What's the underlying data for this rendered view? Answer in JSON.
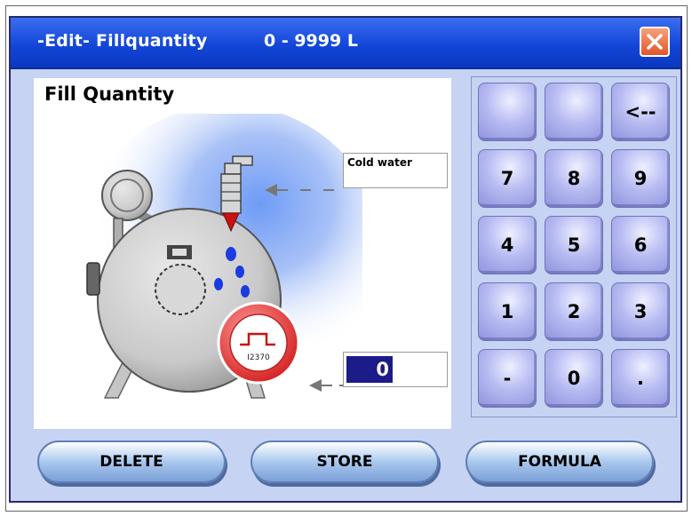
{
  "window": {
    "title": "-Edit- Fillquantity",
    "range": "0 - 9999 L",
    "close_icon": "close-icon"
  },
  "panel": {
    "title": "Fill Quantity",
    "description": "Cold water",
    "value": "0",
    "meter_label": "I2370"
  },
  "keypad": {
    "keys": [
      {
        "label": "",
        "name": "key-blank-1"
      },
      {
        "label": "",
        "name": "key-blank-2"
      },
      {
        "label": "<--",
        "name": "key-backspace"
      },
      {
        "label": "7",
        "name": "key-7"
      },
      {
        "label": "8",
        "name": "key-8"
      },
      {
        "label": "9",
        "name": "key-9"
      },
      {
        "label": "4",
        "name": "key-4"
      },
      {
        "label": "5",
        "name": "key-5"
      },
      {
        "label": "6",
        "name": "key-6"
      },
      {
        "label": "1",
        "name": "key-1"
      },
      {
        "label": "2",
        "name": "key-2"
      },
      {
        "label": "3",
        "name": "key-3"
      },
      {
        "label": "-",
        "name": "key-minus"
      },
      {
        "label": "0",
        "name": "key-0"
      },
      {
        "label": ".",
        "name": "key-dot"
      }
    ]
  },
  "buttons": {
    "delete": "DELETE",
    "store": "STORE",
    "formula": "FORMULA"
  }
}
